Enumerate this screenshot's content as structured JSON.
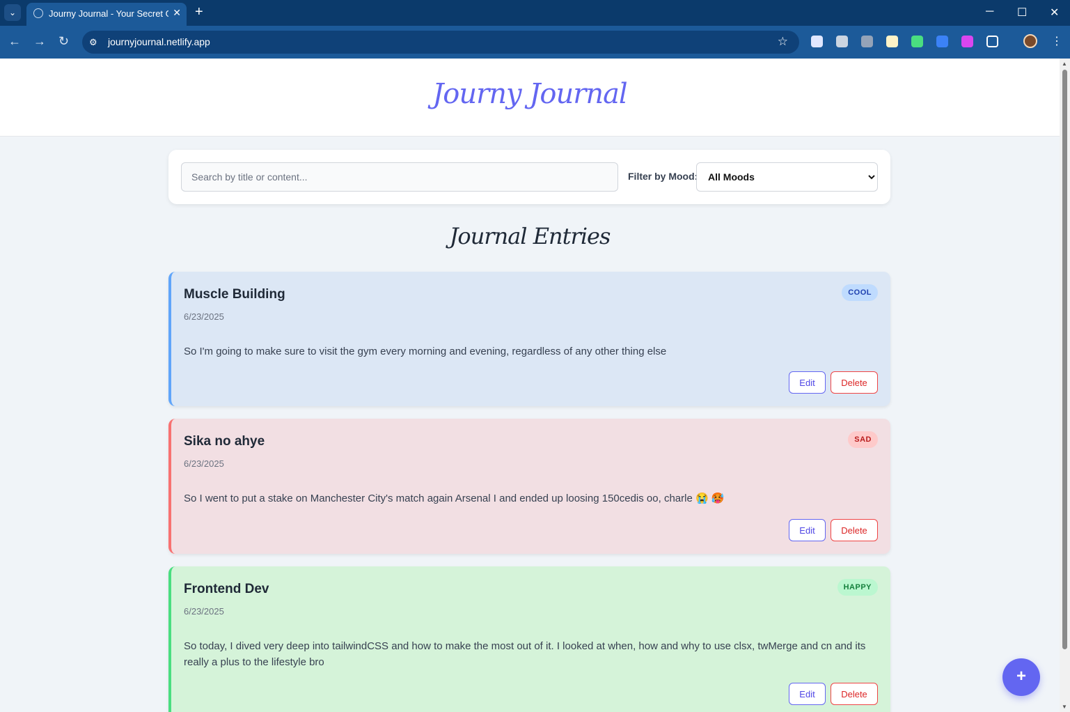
{
  "browser": {
    "tab_title": "Journy Journal - Your Secret Go",
    "url": "journyjournal.netlify.app",
    "new_tab": "+",
    "tab_close": "✕",
    "tab_menu": "⌄",
    "window_controls": {
      "minimize": "─",
      "maximize": "☐",
      "close": "✕"
    },
    "nav": {
      "back": "←",
      "forward": "→",
      "reload": "↻"
    },
    "extension_icons": [
      "eyedropper-icon",
      "camera-icon",
      "figure-icon",
      "sheet-icon",
      "globe-check-icon",
      "translate-icon",
      "pink-app-icon",
      "puzzle-icon"
    ]
  },
  "app": {
    "logo": "Journy Journal",
    "search": {
      "placeholder": "Search by title or content...",
      "value": ""
    },
    "filter": {
      "label": "Filter by Mood:",
      "selected": "All Moods"
    },
    "section_title": "Journal Entries",
    "fab_label": "+"
  },
  "entries": [
    {
      "title": "Muscle Building",
      "date": "6/23/2025",
      "mood": "COOL",
      "content": "So I'm going to make sure to visit the gym every morning and evening, regardless of any other thing else",
      "edit_label": "Edit",
      "delete_label": "Delete",
      "color": "#60a5fa"
    },
    {
      "title": "Sika no ahye",
      "date": "6/23/2025",
      "mood": "SAD",
      "content": "So I went to put a stake on Manchester City's match again Arsenal I and ended up loosing 150cedis oo, charle 😭 🥵",
      "edit_label": "Edit",
      "delete_label": "Delete",
      "color": "#f87171"
    },
    {
      "title": "Frontend Dev",
      "date": "6/23/2025",
      "mood": "HAPPY",
      "content": "So today, I dived very deep into tailwindCSS and how to make the most out of it. I looked at when, how and why to use clsx, twMerge and cn and its really a plus to the lifestyle bro",
      "edit_label": "Edit",
      "delete_label": "Delete",
      "color": "#4ade80"
    }
  ]
}
